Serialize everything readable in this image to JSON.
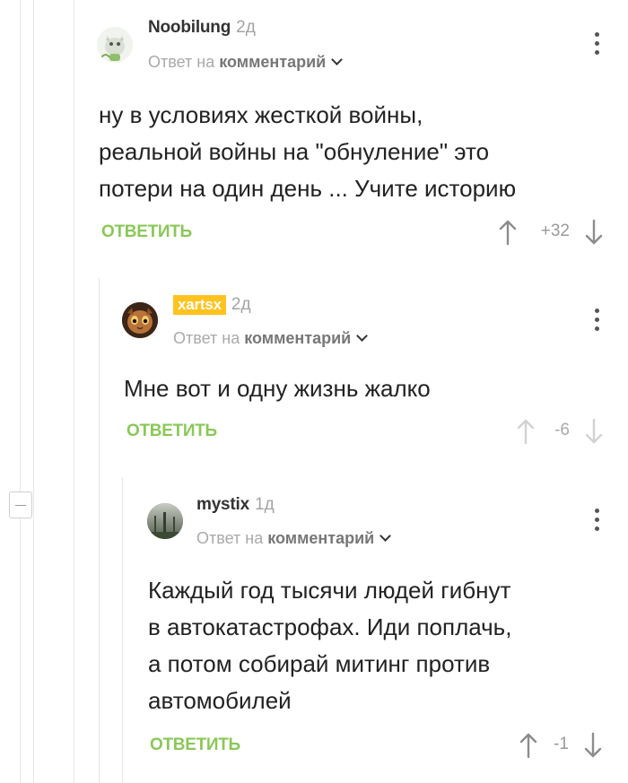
{
  "comments": [
    {
      "author": "Noobilung",
      "time": "2д",
      "reply_prefix": "Ответ на",
      "reply_link": "комментарий",
      "text_lines": [
        "ну в условиях жесткой войны,",
        "реальной  войны на \"обнуление\" это",
        "потери  на один день ... Учите историю"
      ],
      "reply_label": "ОТВЕТИТЬ",
      "score": "+32"
    },
    {
      "author": "xartsx",
      "time": "2д",
      "reply_prefix": "Ответ на",
      "reply_link": "комментарий",
      "text_lines": [
        "Мне вот и одну жизнь жалко"
      ],
      "reply_label": "ОТВЕТИТЬ",
      "score": "-6"
    },
    {
      "author": "mystix",
      "time": "1д",
      "reply_prefix": "Ответ на",
      "reply_link": "комментарий",
      "text_lines": [
        "Каждый год тысячи людей гибнут",
        "в автокатастрофах. Иди поплачь,",
        "а потом собирай митинг против",
        "автомобилей"
      ],
      "reply_label": "ОТВЕТИТЬ",
      "score": "-1"
    }
  ],
  "colors": {
    "reply_green": "#8ac858",
    "badge_yellow": "#ffc31f",
    "muted_gray": "#a3a3a3"
  },
  "icons": [
    "collapse-thread-icon",
    "more-options-icon",
    "upvote-arrow-icon",
    "downvote-arrow-icon",
    "chevron-down-icon"
  ]
}
